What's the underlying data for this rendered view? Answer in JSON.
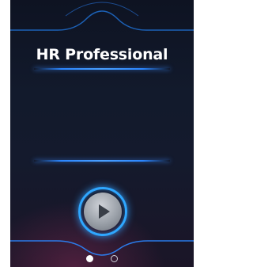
{
  "screen": {
    "mode_caption": "",
    "title": "HR Professional"
  },
  "controls": {
    "play_icon": "play-icon"
  },
  "pagination": {
    "total_pages": 2,
    "current_page": 1
  },
  "colors": {
    "accent": "#2fa7ff",
    "divider": "#2b86ff",
    "background_top": "#0e1322",
    "background_bottom": "#1b1527",
    "title_text": "#ffffff"
  }
}
